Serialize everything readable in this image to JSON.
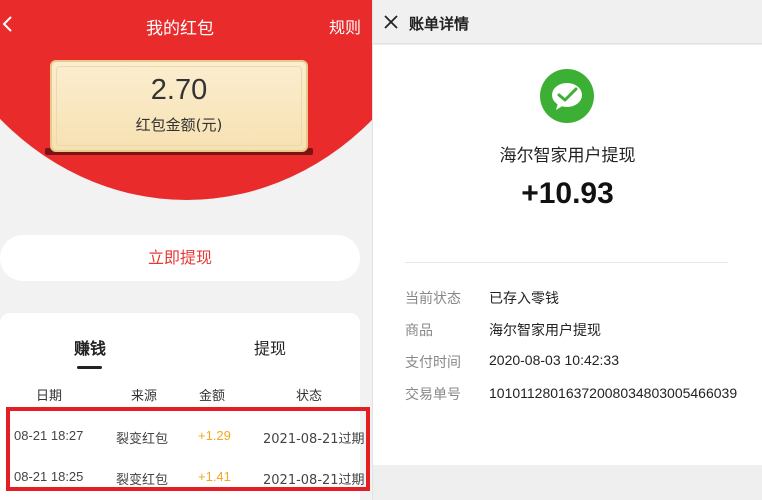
{
  "left": {
    "header": {
      "title": "我的红包",
      "rules_label": "规则"
    },
    "card": {
      "amount": "2.70",
      "label": "红包金额(元)"
    },
    "withdraw_button": "立即提现",
    "tabs": [
      {
        "label": "赚钱",
        "active": true
      },
      {
        "label": "提现",
        "active": false
      }
    ],
    "table": {
      "headers": [
        "日期",
        "来源",
        "金额",
        "状态"
      ],
      "rows": [
        {
          "date": "08-21 18:27",
          "source": "裂变红包",
          "amount": "+1.29",
          "status": "2021-08-21过期"
        },
        {
          "date": "08-21 18:25",
          "source": "裂变红包",
          "amount": "+1.41",
          "status": "2021-08-21过期"
        }
      ]
    },
    "colors": {
      "brand_red": "#e92b2b",
      "amount_orange": "#f5a623",
      "highlight": "#e31e24"
    }
  },
  "right": {
    "header": {
      "title": "账单详情"
    },
    "merchant": "海尔智家用户提现",
    "amount": "+10.93",
    "details": [
      {
        "label": "当前状态",
        "value": "已存入零钱"
      },
      {
        "label": "商品",
        "value": "海尔智家用户提现"
      },
      {
        "label": "支付时间",
        "value": "2020-08-03 10:42:33"
      },
      {
        "label": "交易单号",
        "value": "10101128016372008034803005466039"
      }
    ],
    "icon": "wechat-pay-icon",
    "colors": {
      "wechat_green": "#3cb035"
    }
  }
}
